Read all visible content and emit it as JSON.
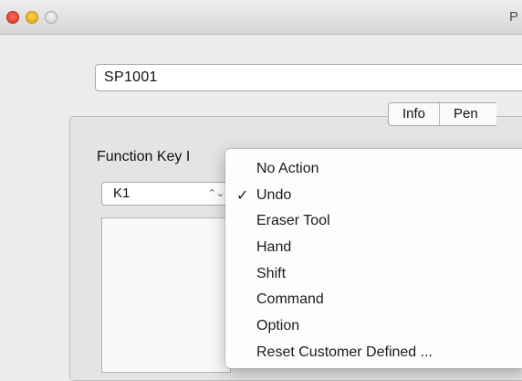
{
  "window": {
    "title": "P"
  },
  "device": {
    "name": "SP1001"
  },
  "tabs": [
    {
      "label": "Info"
    },
    {
      "label": "Pen"
    }
  ],
  "function_key": {
    "label": "Function Key I",
    "selected_key": "K1",
    "select_arrows": "⌃⌄"
  },
  "menu": {
    "check_glyph": "✓",
    "items": [
      {
        "label": "No Action",
        "checked": false
      },
      {
        "label": "Undo",
        "checked": true
      },
      {
        "label": "Eraser Tool",
        "checked": false
      },
      {
        "label": "Hand",
        "checked": false
      },
      {
        "label": "Shift",
        "checked": false
      },
      {
        "label": "Command",
        "checked": false
      },
      {
        "label": "Option",
        "checked": false
      },
      {
        "label": "Reset Customer Defined ...",
        "checked": false
      }
    ]
  }
}
